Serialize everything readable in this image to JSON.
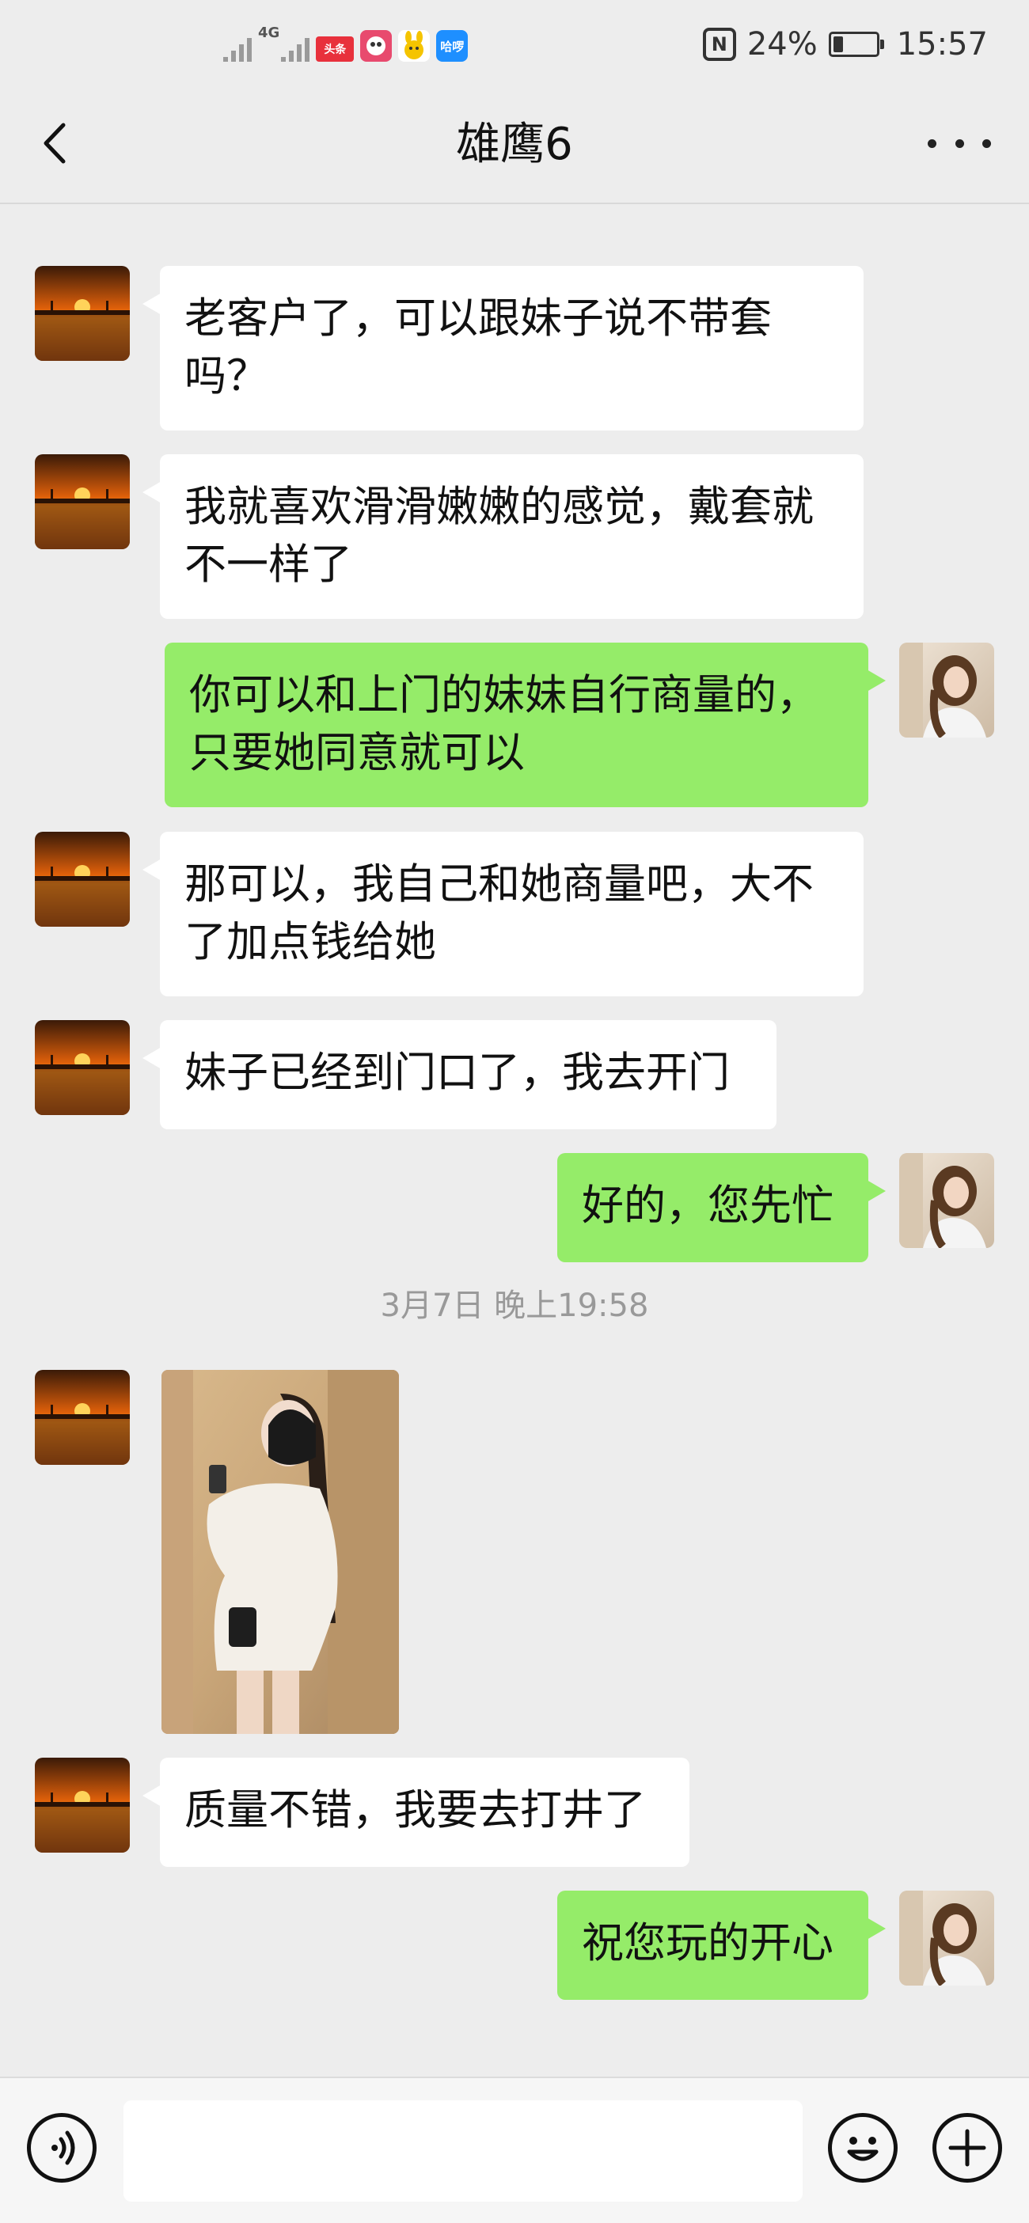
{
  "status_bar": {
    "network_label": "4G",
    "app_badges": [
      {
        "label": "头条",
        "color": "#e8313c"
      },
      {
        "label": "",
        "color": "#e84a6e"
      },
      {
        "label": "",
        "color": "#f5c400"
      },
      {
        "label": "哈啰",
        "color": "#1e8fff"
      }
    ],
    "nfc_icon": "N",
    "battery": "24%",
    "battery_level": 0.24,
    "time": "15:57"
  },
  "header": {
    "back_icon": "chevron-left-icon",
    "title": "雄鹰6",
    "more_icon": "more-dots-icon"
  },
  "colors": {
    "background": "#ededed",
    "incoming_bubble": "#ffffff",
    "outgoing_bubble": "#95ec69",
    "timestamp_text": "#999999"
  },
  "messages": [
    {
      "from": "contact",
      "text": "老客户了，可以跟妹子说不带套\n吗？"
    },
    {
      "from": "contact",
      "text": "我就喜欢滑滑嫩嫩的感觉，戴套就\n不一样了"
    },
    {
      "from": "me",
      "text": "你可以和上门的妹妹自行商量的，\n只要她同意就可以"
    },
    {
      "from": "contact",
      "text": "那可以，我自己和她商量吧，大不\n了加点钱给她"
    },
    {
      "from": "contact",
      "text": "妹子已经到门口了，我去开门"
    },
    {
      "from": "me",
      "text": "好的，您先忙"
    },
    {
      "from": "contact",
      "text": "质量不错，我要去打井了"
    },
    {
      "from": "me",
      "text": "祝您玩的开心"
    }
  ],
  "timestamp": "3月7日 晚上19:58",
  "photo_message": {
    "from": "contact",
    "type": "image"
  },
  "input_bar": {
    "voice_icon": "voice-icon",
    "input_value": "",
    "emoji_icon": "emoji-icon",
    "plus_icon": "plus-icon"
  }
}
